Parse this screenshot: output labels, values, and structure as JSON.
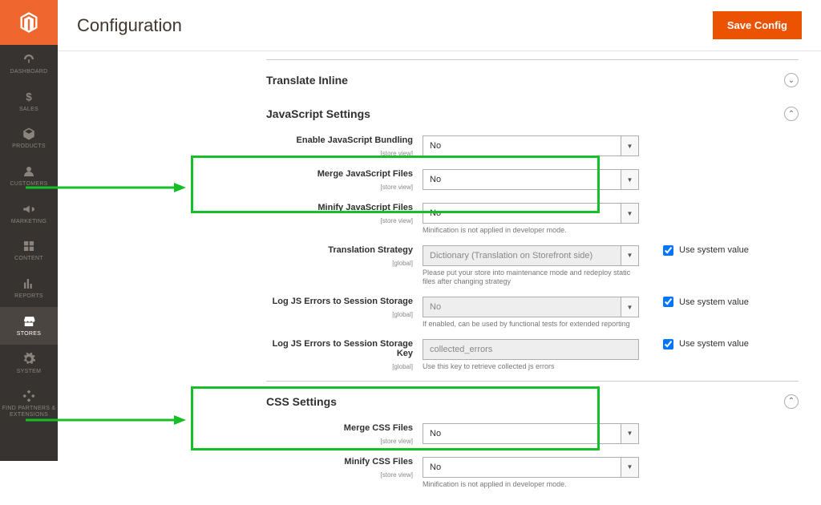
{
  "header": {
    "title": "Configuration",
    "save_label": "Save Config"
  },
  "nav": [
    {
      "label": "DASHBOARD"
    },
    {
      "label": "SALES"
    },
    {
      "label": "PRODUCTS"
    },
    {
      "label": "CUSTOMERS"
    },
    {
      "label": "MARKETING"
    },
    {
      "label": "CONTENT"
    },
    {
      "label": "REPORTS"
    },
    {
      "label": "STORES"
    },
    {
      "label": "SYSTEM"
    },
    {
      "label": "FIND PARTNERS & EXTENSIONS"
    }
  ],
  "sections": {
    "translate_inline": {
      "title": "Translate Inline"
    },
    "js": {
      "title": "JavaScript Settings",
      "bundling_label": "Enable JavaScript Bundling",
      "bundling_scope": "[store view]",
      "bundling_value": "No",
      "merge_label": "Merge JavaScript Files",
      "merge_scope": "[store view]",
      "merge_value": "No",
      "minify_label": "Minify JavaScript Files",
      "minify_scope": "[store view]",
      "minify_value": "No",
      "minify_help": "Minification is not applied in developer mode.",
      "translation_label": "Translation Strategy",
      "translation_scope": "[global]",
      "translation_value": "Dictionary (Translation on Storefront side)",
      "translation_help": "Please put your store into maintenance mode and redeploy static files after changing strategy",
      "logjs_label": "Log JS Errors to Session Storage",
      "logjs_scope": "[global]",
      "logjs_value": "No",
      "logjs_help": "If enabled, can be used by functional tests for extended reporting",
      "logjskey_label": "Log JS Errors to Session Storage Key",
      "logjskey_scope": "[global]",
      "logjskey_value": "collected_errors",
      "logjskey_help": "Use this key to retrieve collected js errors",
      "use_system_label": "Use system value"
    },
    "css": {
      "title": "CSS Settings",
      "merge_label": "Merge CSS Files",
      "merge_scope": "[store view]",
      "merge_value": "No",
      "minify_label": "Minify CSS Files",
      "minify_scope": "[store view]",
      "minify_value": "No",
      "minify_help": "Minification is not applied in developer mode."
    }
  }
}
